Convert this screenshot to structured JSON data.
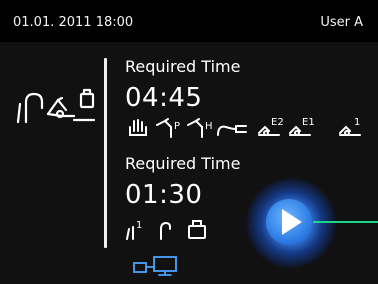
{
  "status_bar": {
    "datetime": "01.01. 2011 18:00",
    "user": "User A"
  },
  "program_1": {
    "label": "Required Time",
    "time": "04:45",
    "step_icons": [
      "handwash-icon",
      "handpiece-p-icon",
      "handpiece-h-icon",
      "hose-icon",
      "instrument-e2-icon",
      "instrument-e1-icon",
      "instrument-1-icon"
    ],
    "superscripts": {
      "e2": "E2",
      "e1": "E1",
      "one": "1"
    }
  },
  "program_2": {
    "label": "Required Time",
    "time": "01:30",
    "step_icons": [
      "tube-1-icon",
      "tube-icon",
      "chamber-icon"
    ],
    "superscripts": {
      "one": "1"
    }
  },
  "colors": {
    "background": "#111111",
    "status_bar": "#000000",
    "play_button": "#2f7fe6",
    "connector_line": "#19d88c"
  }
}
